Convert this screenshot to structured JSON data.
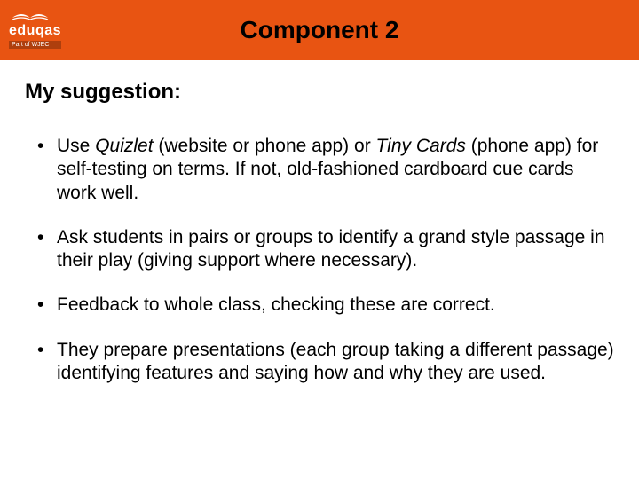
{
  "header": {
    "logo_text": "eduqas",
    "logo_sub": "Part of WJEC",
    "title": "Component 2"
  },
  "content": {
    "subhead": "My suggestion:",
    "bullets": [
      {
        "pre": "Use ",
        "em1": "Quizlet",
        "mid": " (website or phone app) or ",
        "em2": "Tiny Cards",
        "post": " (phone app) for self-testing on terms. If not, old-fashioned cardboard cue cards work well."
      },
      {
        "text": "Ask students in pairs or groups to identify a grand style passage in their play (giving support where necessary)."
      },
      {
        "text": "Feedback to whole class, checking these are correct."
      },
      {
        "text": "They prepare presentations (each group taking a different passage) identifying features and saying how and why they are used."
      }
    ]
  }
}
